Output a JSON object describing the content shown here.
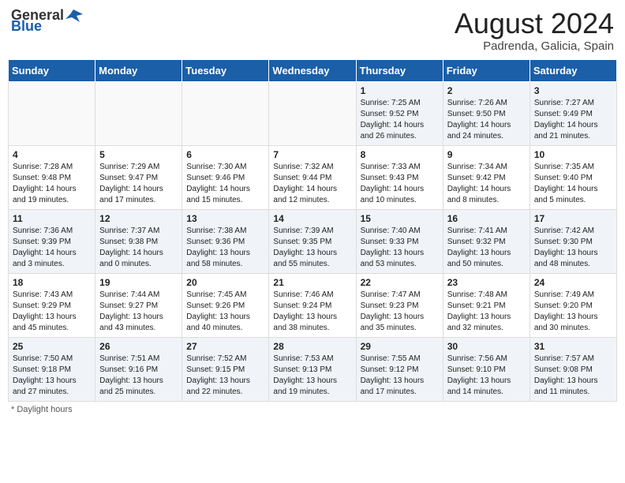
{
  "header": {
    "logo_general": "General",
    "logo_blue": "Blue",
    "month_year": "August 2024",
    "location": "Padrenda, Galicia, Spain"
  },
  "weekdays": [
    "Sunday",
    "Monday",
    "Tuesday",
    "Wednesday",
    "Thursday",
    "Friday",
    "Saturday"
  ],
  "weeks": [
    [
      {
        "day": "",
        "sunrise": "",
        "sunset": "",
        "daylight": ""
      },
      {
        "day": "",
        "sunrise": "",
        "sunset": "",
        "daylight": ""
      },
      {
        "day": "",
        "sunrise": "",
        "sunset": "",
        "daylight": ""
      },
      {
        "day": "",
        "sunrise": "",
        "sunset": "",
        "daylight": ""
      },
      {
        "day": "1",
        "sunrise": "Sunrise: 7:25 AM",
        "sunset": "Sunset: 9:52 PM",
        "daylight": "Daylight: 14 hours and 26 minutes."
      },
      {
        "day": "2",
        "sunrise": "Sunrise: 7:26 AM",
        "sunset": "Sunset: 9:50 PM",
        "daylight": "Daylight: 14 hours and 24 minutes."
      },
      {
        "day": "3",
        "sunrise": "Sunrise: 7:27 AM",
        "sunset": "Sunset: 9:49 PM",
        "daylight": "Daylight: 14 hours and 21 minutes."
      }
    ],
    [
      {
        "day": "4",
        "sunrise": "Sunrise: 7:28 AM",
        "sunset": "Sunset: 9:48 PM",
        "daylight": "Daylight: 14 hours and 19 minutes."
      },
      {
        "day": "5",
        "sunrise": "Sunrise: 7:29 AM",
        "sunset": "Sunset: 9:47 PM",
        "daylight": "Daylight: 14 hours and 17 minutes."
      },
      {
        "day": "6",
        "sunrise": "Sunrise: 7:30 AM",
        "sunset": "Sunset: 9:46 PM",
        "daylight": "Daylight: 14 hours and 15 minutes."
      },
      {
        "day": "7",
        "sunrise": "Sunrise: 7:32 AM",
        "sunset": "Sunset: 9:44 PM",
        "daylight": "Daylight: 14 hours and 12 minutes."
      },
      {
        "day": "8",
        "sunrise": "Sunrise: 7:33 AM",
        "sunset": "Sunset: 9:43 PM",
        "daylight": "Daylight: 14 hours and 10 minutes."
      },
      {
        "day": "9",
        "sunrise": "Sunrise: 7:34 AM",
        "sunset": "Sunset: 9:42 PM",
        "daylight": "Daylight: 14 hours and 8 minutes."
      },
      {
        "day": "10",
        "sunrise": "Sunrise: 7:35 AM",
        "sunset": "Sunset: 9:40 PM",
        "daylight": "Daylight: 14 hours and 5 minutes."
      }
    ],
    [
      {
        "day": "11",
        "sunrise": "Sunrise: 7:36 AM",
        "sunset": "Sunset: 9:39 PM",
        "daylight": "Daylight: 14 hours and 3 minutes."
      },
      {
        "day": "12",
        "sunrise": "Sunrise: 7:37 AM",
        "sunset": "Sunset: 9:38 PM",
        "daylight": "Daylight: 14 hours and 0 minutes."
      },
      {
        "day": "13",
        "sunrise": "Sunrise: 7:38 AM",
        "sunset": "Sunset: 9:36 PM",
        "daylight": "Daylight: 13 hours and 58 minutes."
      },
      {
        "day": "14",
        "sunrise": "Sunrise: 7:39 AM",
        "sunset": "Sunset: 9:35 PM",
        "daylight": "Daylight: 13 hours and 55 minutes."
      },
      {
        "day": "15",
        "sunrise": "Sunrise: 7:40 AM",
        "sunset": "Sunset: 9:33 PM",
        "daylight": "Daylight: 13 hours and 53 minutes."
      },
      {
        "day": "16",
        "sunrise": "Sunrise: 7:41 AM",
        "sunset": "Sunset: 9:32 PM",
        "daylight": "Daylight: 13 hours and 50 minutes."
      },
      {
        "day": "17",
        "sunrise": "Sunrise: 7:42 AM",
        "sunset": "Sunset: 9:30 PM",
        "daylight": "Daylight: 13 hours and 48 minutes."
      }
    ],
    [
      {
        "day": "18",
        "sunrise": "Sunrise: 7:43 AM",
        "sunset": "Sunset: 9:29 PM",
        "daylight": "Daylight: 13 hours and 45 minutes."
      },
      {
        "day": "19",
        "sunrise": "Sunrise: 7:44 AM",
        "sunset": "Sunset: 9:27 PM",
        "daylight": "Daylight: 13 hours and 43 minutes."
      },
      {
        "day": "20",
        "sunrise": "Sunrise: 7:45 AM",
        "sunset": "Sunset: 9:26 PM",
        "daylight": "Daylight: 13 hours and 40 minutes."
      },
      {
        "day": "21",
        "sunrise": "Sunrise: 7:46 AM",
        "sunset": "Sunset: 9:24 PM",
        "daylight": "Daylight: 13 hours and 38 minutes."
      },
      {
        "day": "22",
        "sunrise": "Sunrise: 7:47 AM",
        "sunset": "Sunset: 9:23 PM",
        "daylight": "Daylight: 13 hours and 35 minutes."
      },
      {
        "day": "23",
        "sunrise": "Sunrise: 7:48 AM",
        "sunset": "Sunset: 9:21 PM",
        "daylight": "Daylight: 13 hours and 32 minutes."
      },
      {
        "day": "24",
        "sunrise": "Sunrise: 7:49 AM",
        "sunset": "Sunset: 9:20 PM",
        "daylight": "Daylight: 13 hours and 30 minutes."
      }
    ],
    [
      {
        "day": "25",
        "sunrise": "Sunrise: 7:50 AM",
        "sunset": "Sunset: 9:18 PM",
        "daylight": "Daylight: 13 hours and 27 minutes."
      },
      {
        "day": "26",
        "sunrise": "Sunrise: 7:51 AM",
        "sunset": "Sunset: 9:16 PM",
        "daylight": "Daylight: 13 hours and 25 minutes."
      },
      {
        "day": "27",
        "sunrise": "Sunrise: 7:52 AM",
        "sunset": "Sunset: 9:15 PM",
        "daylight": "Daylight: 13 hours and 22 minutes."
      },
      {
        "day": "28",
        "sunrise": "Sunrise: 7:53 AM",
        "sunset": "Sunset: 9:13 PM",
        "daylight": "Daylight: 13 hours and 19 minutes."
      },
      {
        "day": "29",
        "sunrise": "Sunrise: 7:55 AM",
        "sunset": "Sunset: 9:12 PM",
        "daylight": "Daylight: 13 hours and 17 minutes."
      },
      {
        "day": "30",
        "sunrise": "Sunrise: 7:56 AM",
        "sunset": "Sunset: 9:10 PM",
        "daylight": "Daylight: 13 hours and 14 minutes."
      },
      {
        "day": "31",
        "sunrise": "Sunrise: 7:57 AM",
        "sunset": "Sunset: 9:08 PM",
        "daylight": "Daylight: 13 hours and 11 minutes."
      }
    ]
  ],
  "footer": {
    "note": "Daylight hours"
  }
}
